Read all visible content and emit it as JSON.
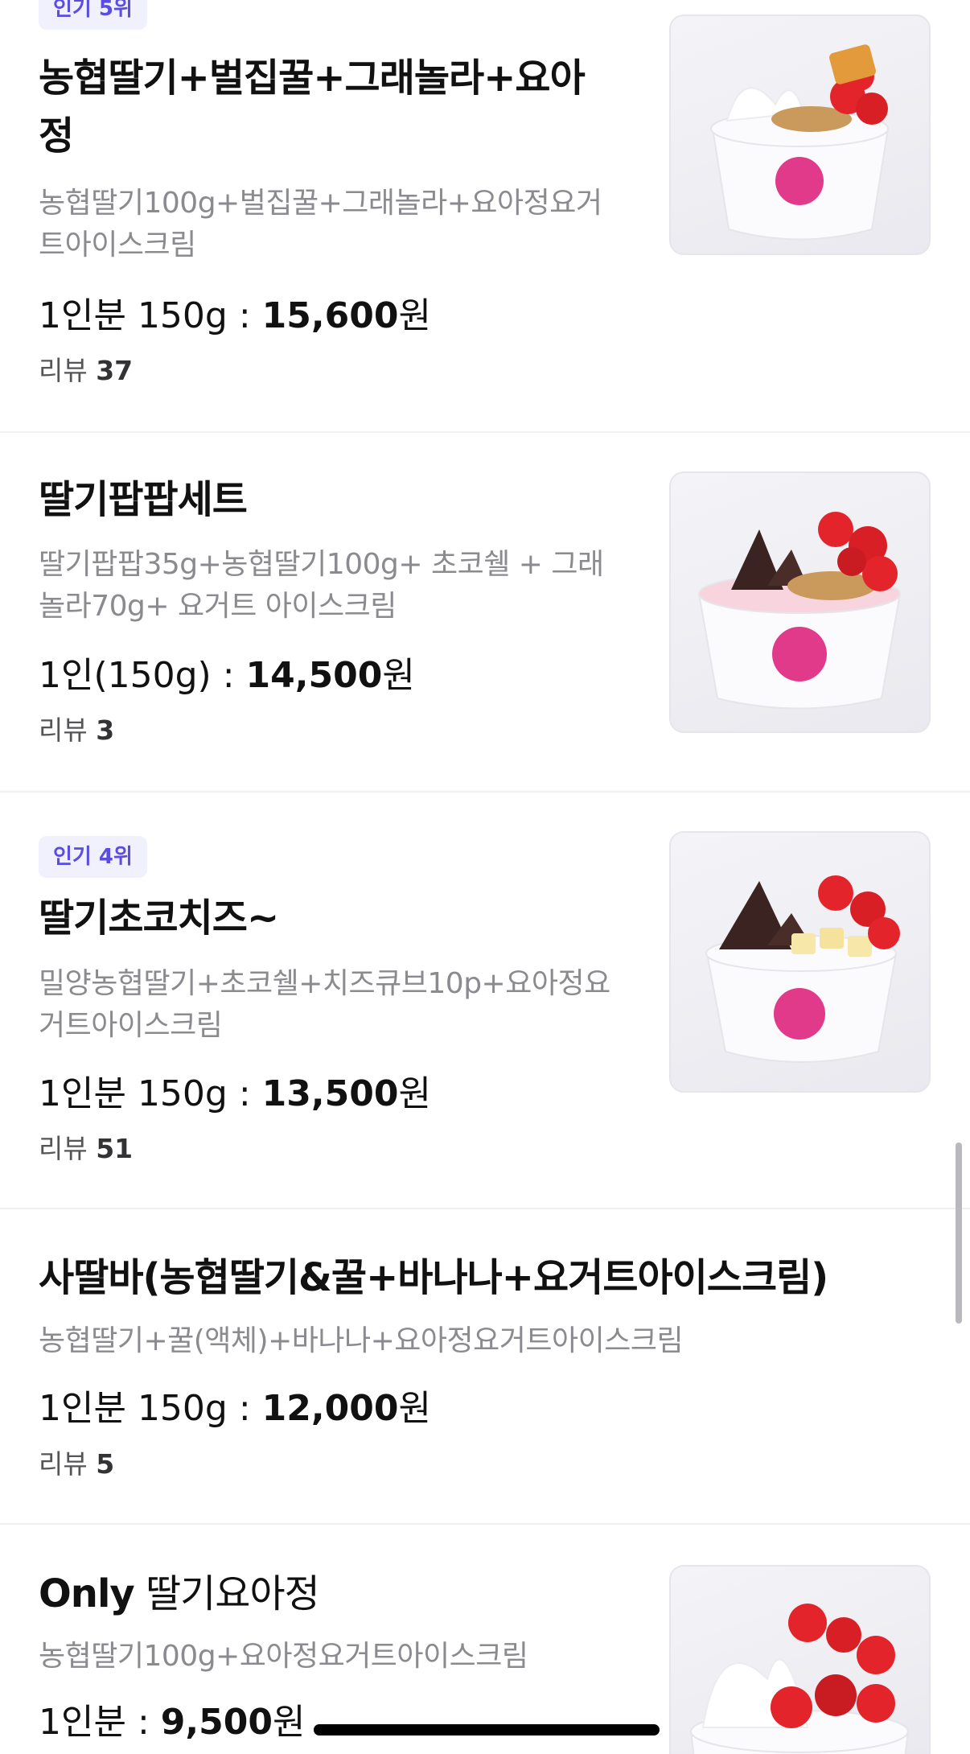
{
  "menu": {
    "items": [
      {
        "badge": "인기 5위",
        "name_line1": "농협딸기+벌집꿀+그래놀라+요아",
        "name_line2": "정",
        "desc_line1": "농협딸기100g+벌집꿀+그래놀라+요아정요거",
        "desc_line2": "트아이스크림",
        "price_label": "1인분 150g : ",
        "price_amount": "15,600",
        "price_unit": "원",
        "review_label": "리뷰 ",
        "review_count": "37",
        "image_icon": "honeycomb-strawberry-yogurt-cup"
      },
      {
        "name_line1": "딸기팝팝세트",
        "desc_line1": "딸기팝팝35g+농협딸기100g+ 초코쉘 + 그래",
        "desc_line2": "놀라70g+ 요거트 아이스크림",
        "price_label": "1인(150g) : ",
        "price_amount": "14,500",
        "price_unit": "원",
        "review_label": "리뷰 ",
        "review_count": "3",
        "image_icon": "strawberry-popping-choco-yogurt-cup"
      },
      {
        "badge": "인기 4위",
        "name_line1": "딸기초코치즈~",
        "desc_line1": "밀양농협딸기+초코쉘+치즈큐브10p+요아정요",
        "desc_line2": "거트아이스크림",
        "price_label": "1인분 150g : ",
        "price_amount": "13,500",
        "price_unit": "원",
        "review_label": "리뷰 ",
        "review_count": "51",
        "image_icon": "strawberry-choco-cheese-yogurt-cup"
      },
      {
        "name_line1": "사딸바(농협딸기&꿀+바나나+요거트아이스크림)",
        "desc_line1": "농협딸기+꿀(액체)+바나나+요아정요거트아이스크림",
        "price_label": "1인분 150g : ",
        "price_amount": "12,000",
        "price_unit": "원",
        "review_label": "리뷰 ",
        "review_count": "5"
      },
      {
        "name_prefix": "Only",
        "name_line1": " 딸기요아정",
        "desc_line1": "농협딸기100g+요아정요거트아이스크림",
        "price_label": "1인분 : ",
        "price_amount": "9,500",
        "price_unit": "원",
        "image_icon": "strawberry-yogurt-cup"
      }
    ]
  },
  "colors": {
    "badge_text": "#5b4de0",
    "badge_bg": "#f1f0fd",
    "cup_pink": "#e23a8a",
    "strawberry": "#e3242b"
  }
}
